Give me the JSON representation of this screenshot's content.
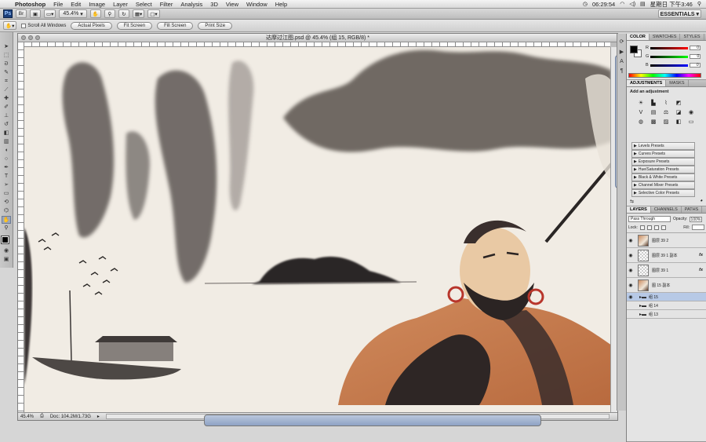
{
  "menubar": {
    "apple": "",
    "items": [
      "Photoshop",
      "File",
      "Edit",
      "Image",
      "Layer",
      "Select",
      "Filter",
      "Analysis",
      "3D",
      "View",
      "Window",
      "Help"
    ],
    "clock_icon": "time-machine-icon",
    "clock_time": "06:29:54",
    "datetime": "星期日 下午3:46",
    "search_icon": "spotlight-icon"
  },
  "appbar": {
    "zoom": "45.4",
    "zoom_suffix": "▾",
    "workspace": "ESSENTIALS ▾"
  },
  "options": {
    "scroll_all": "Scroll All Windows",
    "buttons": [
      "Actual Pixels",
      "Fit Screen",
      "Fill Screen",
      "Print Size"
    ]
  },
  "document": {
    "title": "达摩过江图.psd @ 45.4% (组 15, RGB/8) *",
    "status_zoom": "45.4%",
    "doc_size": "Doc: 104.2M/1.73G"
  },
  "color_panel": {
    "tabs": [
      "COLOR",
      "SWATCHES",
      "STYLES"
    ],
    "channels": [
      {
        "name": "R",
        "value": "0"
      },
      {
        "name": "G",
        "value": "0"
      },
      {
        "name": "B",
        "value": "0"
      }
    ],
    "fg": "#000000",
    "bg": "#ffffff"
  },
  "adjustments_panel": {
    "tabs": [
      "ADJUSTMENTS",
      "MASKS"
    ],
    "heading": "Add an adjustment",
    "presets": [
      "Levels Presets",
      "Curves Presets",
      "Exposure Presets",
      "Hue/Saturation Presets",
      "Black & White Presets",
      "Channel Mixer Presets",
      "Selective Color Presets"
    ]
  },
  "layers_panel": {
    "tabs": [
      "LAYERS",
      "CHANNELS",
      "PATHS"
    ],
    "blend_mode": "Pass Through",
    "opacity_label": "Opacity:",
    "opacity": "100%",
    "lock_label": "Lock:",
    "fill_label": "Fill:",
    "layers": [
      {
        "name": "图层 39 2",
        "fx": ""
      },
      {
        "name": "图层 39 1 副本",
        "fx": "fx"
      },
      {
        "name": "图层 39 1",
        "fx": "fx"
      },
      {
        "name": "图 15 副本",
        "fx": ""
      },
      {
        "name": "组 15",
        "fx": ""
      },
      {
        "name": "组 14",
        "fx": ""
      },
      {
        "name": "组 13",
        "fx": ""
      }
    ]
  }
}
